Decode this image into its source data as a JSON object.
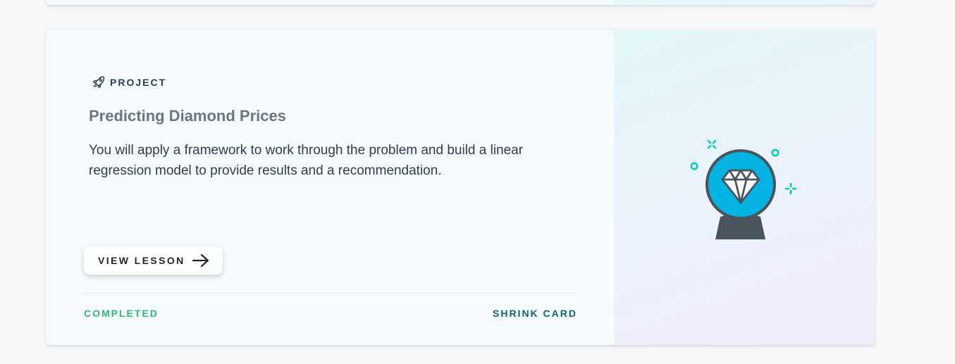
{
  "card": {
    "eyebrow": "PROJECT",
    "title": "Predicting Diamond Prices",
    "description": "You will apply a framework to work through the problem and build a linear regression model to provide results and a recommendation.",
    "view_button_label": "VIEW LESSON",
    "status": "COMPLETED",
    "shrink_label": "SHRINK CARD",
    "icons": {
      "eyebrow": "rocket-icon",
      "button": "arrow-right-icon",
      "illustration": "diamond-crystal-ball-illustration"
    }
  },
  "colors": {
    "status_completed": "#2fb874",
    "shrink_link": "#15607b",
    "title": "#6b767e",
    "text": "#2e3d49",
    "globe": "#02b3e4",
    "sparkle": "#02ccba",
    "base": "#4a545c"
  }
}
